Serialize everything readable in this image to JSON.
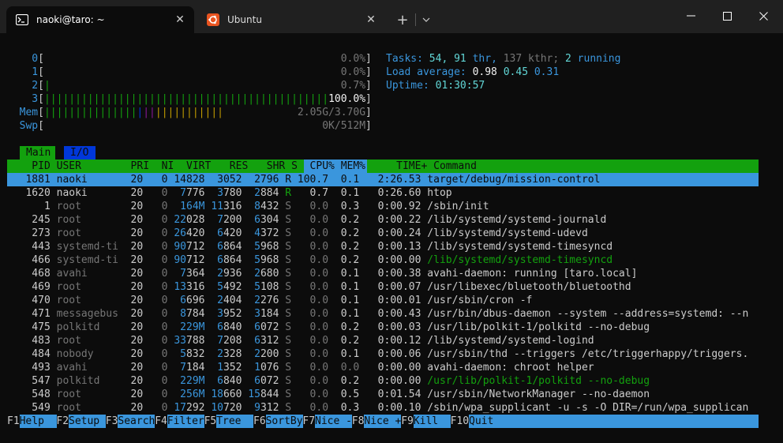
{
  "window": {
    "tabs": [
      {
        "title": "naoki@taro: ~",
        "icon": "terminal-icon",
        "active": true
      },
      {
        "title": "Ubuntu",
        "icon": "ubuntu-icon",
        "active": false
      }
    ],
    "new_tab": "+",
    "close_glyph": "✕"
  },
  "htop": {
    "cpus": [
      {
        "label": "0",
        "percent": "0.0%",
        "level": 0.0
      },
      {
        "label": "1",
        "percent": "0.0%",
        "level": 0.0
      },
      {
        "label": "2",
        "percent": "0.7%",
        "level": 0.007
      },
      {
        "label": "3",
        "percent": "100.0%",
        "level": 1.0
      }
    ],
    "mem": {
      "label": "Mem",
      "value": "2.05G/3.70G",
      "level": 0.554
    },
    "swp": {
      "label": "Swp",
      "value": "0K/512M",
      "level": 0.0
    },
    "tasks": {
      "label": "Tasks:",
      "count": "54,",
      "thr": "91",
      "thr_label": "thr,",
      "kthr": "137 kthr;",
      "running": "2",
      "running_label": "running"
    },
    "load": {
      "label": "Load average:",
      "v1": "0.98",
      "v5": "0.45",
      "v15": "0.31"
    },
    "uptime": {
      "label": "Uptime:",
      "value": "01:30:57"
    },
    "screen_tabs": [
      "Main",
      "I/O"
    ],
    "columns": [
      "PID",
      "USER",
      "PRI",
      "NI",
      "VIRT",
      "RES",
      "SHR",
      "S",
      "CPU%",
      "MEM%",
      "TIME+",
      "Command"
    ],
    "processes": [
      {
        "pid": "1881",
        "user": "naoki",
        "pri": "20",
        "ni": "0",
        "virt": "14828",
        "res": "3052",
        "shr": "2796",
        "s": "R",
        "cpu": "100.7",
        "mem": "0.1",
        "time": "2:26.53",
        "cmd": "target/debug/mission-control",
        "selected": true
      },
      {
        "pid": "1620",
        "user": "naoki",
        "pri": "20",
        "ni": "0",
        "virt": "7776",
        "res": "3780",
        "shr": "2884",
        "s": "R",
        "cpu": "0.7",
        "mem": "0.1",
        "time": "0:26.60",
        "cmd": "htop"
      },
      {
        "pid": "1",
        "user": "root",
        "pri": "20",
        "ni": "0",
        "virt": "164M",
        "res": "11316",
        "shr": "8432",
        "s": "S",
        "cpu": "0.0",
        "mem": "0.3",
        "time": "0:00.92",
        "cmd": "/sbin/init"
      },
      {
        "pid": "245",
        "user": "root",
        "pri": "20",
        "ni": "0",
        "virt": "22028",
        "res": "7200",
        "shr": "6304",
        "s": "S",
        "cpu": "0.0",
        "mem": "0.2",
        "time": "0:00.22",
        "cmd": "/lib/systemd/systemd-journald"
      },
      {
        "pid": "273",
        "user": "root",
        "pri": "20",
        "ni": "0",
        "virt": "26420",
        "res": "6420",
        "shr": "4372",
        "s": "S",
        "cpu": "0.0",
        "mem": "0.2",
        "time": "0:00.24",
        "cmd": "/lib/systemd/systemd-udevd"
      },
      {
        "pid": "443",
        "user": "systemd-ti",
        "pri": "20",
        "ni": "0",
        "virt": "90712",
        "res": "6864",
        "shr": "5968",
        "s": "S",
        "cpu": "0.0",
        "mem": "0.2",
        "time": "0:00.13",
        "cmd": "/lib/systemd/systemd-timesyncd"
      },
      {
        "pid": "466",
        "user": "systemd-ti",
        "pri": "20",
        "ni": "0",
        "virt": "90712",
        "res": "6864",
        "shr": "5968",
        "s": "S",
        "cpu": "0.0",
        "mem": "0.2",
        "time": "0:00.00",
        "cmd": "/lib/systemd/systemd-timesyncd",
        "thread": true
      },
      {
        "pid": "468",
        "user": "avahi",
        "pri": "20",
        "ni": "0",
        "virt": "7364",
        "res": "2936",
        "shr": "2680",
        "s": "S",
        "cpu": "0.0",
        "mem": "0.1",
        "time": "0:00.38",
        "cmd": "avahi-daemon: running [taro.local]"
      },
      {
        "pid": "469",
        "user": "root",
        "pri": "20",
        "ni": "0",
        "virt": "13316",
        "res": "5492",
        "shr": "5108",
        "s": "S",
        "cpu": "0.0",
        "mem": "0.1",
        "time": "0:00.07",
        "cmd": "/usr/libexec/bluetooth/bluetoothd"
      },
      {
        "pid": "470",
        "user": "root",
        "pri": "20",
        "ni": "0",
        "virt": "6696",
        "res": "2404",
        "shr": "2276",
        "s": "S",
        "cpu": "0.0",
        "mem": "0.1",
        "time": "0:00.01",
        "cmd": "/usr/sbin/cron -f"
      },
      {
        "pid": "471",
        "user": "messagebus",
        "pri": "20",
        "ni": "0",
        "virt": "8784",
        "res": "3952",
        "shr": "3184",
        "s": "S",
        "cpu": "0.0",
        "mem": "0.1",
        "time": "0:00.43",
        "cmd": "/usr/bin/dbus-daemon --system --address=systemd: --n"
      },
      {
        "pid": "475",
        "user": "polkitd",
        "pri": "20",
        "ni": "0",
        "virt": "229M",
        "res": "6840",
        "shr": "6072",
        "s": "S",
        "cpu": "0.0",
        "mem": "0.2",
        "time": "0:00.03",
        "cmd": "/usr/lib/polkit-1/polkitd --no-debug"
      },
      {
        "pid": "483",
        "user": "root",
        "pri": "20",
        "ni": "0",
        "virt": "33788",
        "res": "7208",
        "shr": "6312",
        "s": "S",
        "cpu": "0.0",
        "mem": "0.2",
        "time": "0:00.12",
        "cmd": "/lib/systemd/systemd-logind"
      },
      {
        "pid": "484",
        "user": "nobody",
        "pri": "20",
        "ni": "0",
        "virt": "5832",
        "res": "2328",
        "shr": "2200",
        "s": "S",
        "cpu": "0.0",
        "mem": "0.1",
        "time": "0:00.06",
        "cmd": "/usr/sbin/thd --triggers /etc/triggerhappy/triggers."
      },
      {
        "pid": "493",
        "user": "avahi",
        "pri": "20",
        "ni": "0",
        "virt": "7184",
        "res": "1352",
        "shr": "1076",
        "s": "S",
        "cpu": "0.0",
        "mem": "0.0",
        "time": "0:00.00",
        "cmd": "avahi-daemon: chroot helper"
      },
      {
        "pid": "547",
        "user": "polkitd",
        "pri": "20",
        "ni": "0",
        "virt": "229M",
        "res": "6840",
        "shr": "6072",
        "s": "S",
        "cpu": "0.0",
        "mem": "0.2",
        "time": "0:00.00",
        "cmd": "/usr/lib/polkit-1/polkitd --no-debug",
        "thread": true
      },
      {
        "pid": "548",
        "user": "root",
        "pri": "20",
        "ni": "0",
        "virt": "256M",
        "res": "18660",
        "shr": "15844",
        "s": "S",
        "cpu": "0.0",
        "mem": "0.5",
        "time": "0:01.54",
        "cmd": "/usr/sbin/NetworkManager --no-daemon"
      },
      {
        "pid": "549",
        "user": "root",
        "pri": "20",
        "ni": "0",
        "virt": "17292",
        "res": "10720",
        "shr": "9312",
        "s": "S",
        "cpu": "0.0",
        "mem": "0.3",
        "time": "0:00.10",
        "cmd": "/sbin/wpa_supplicant -u -s -O DIR=/run/wpa_supplican"
      }
    ],
    "fkeys": [
      {
        "key": "F1",
        "label": "Help  "
      },
      {
        "key": "F2",
        "label": "Setup "
      },
      {
        "key": "F3",
        "label": "Search"
      },
      {
        "key": "F4",
        "label": "Filter"
      },
      {
        "key": "F5",
        "label": "Tree  "
      },
      {
        "key": "F6",
        "label": "SortBy"
      },
      {
        "key": "F7",
        "label": "Nice -"
      },
      {
        "key": "F8",
        "label": "Nice +"
      },
      {
        "key": "F9",
        "label": "Kill  "
      },
      {
        "key": "F10",
        "label": "Quit"
      }
    ]
  },
  "colors": {
    "terminal_bg": "#0c0c0c",
    "titlebar_bg": "#202020",
    "header_green": "#13a10e",
    "selection_blue": "#3a96dd",
    "io_tab_blue": "#0037da"
  }
}
